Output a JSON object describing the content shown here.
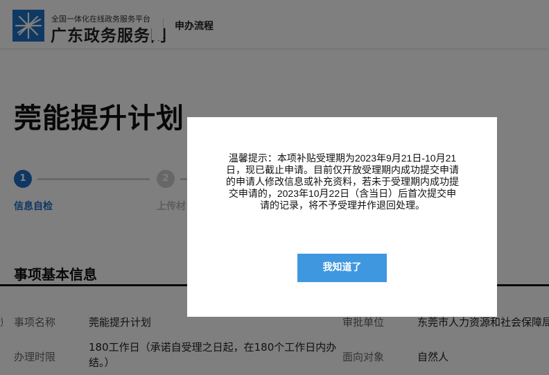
{
  "header": {
    "brand_small": "全国一体化在线政务服务平台",
    "brand_big": "广东政务服务网",
    "nav_link": "申办流程",
    "logo_icon": "guangdong-star-logo-icon"
  },
  "main": {
    "title": "莞能提升计划",
    "steps": [
      {
        "number": "1",
        "label": "信息自检",
        "state": "active"
      },
      {
        "number": "2",
        "label": "上传材",
        "state": "inactive"
      }
    ],
    "section_title": "事项基本信息",
    "info_rows": [
      {
        "label": "事项名称",
        "value": "莞能提升计划"
      },
      {
        "label": "办理时限",
        "value": "180工作日（承诺自受理之日起，在180个工作日内办结。）"
      },
      {
        "label": "审批单位",
        "value": "东莞市人力资源和社会保障局"
      },
      {
        "label": "面向对象",
        "value": "自然人"
      }
    ],
    "cut_text": "意"
  },
  "modal": {
    "message": "温馨提示：本项补贴受理期为2023年9月21日-10月21日，现已截止申请。目前仅开放受理期内成功提交申请的申请人修改信息或补充资料，若未于受理期内成功提交申请的，2023年10月22日（含当日）后首次提交申请的记录，将不予受理并作退回处理。",
    "confirm_label": "我知道了"
  },
  "colors": {
    "accent_blue": "#1e6fc9",
    "button_blue": "#3f97e0",
    "overlay": "rgba(0,0,0,0.5)"
  }
}
